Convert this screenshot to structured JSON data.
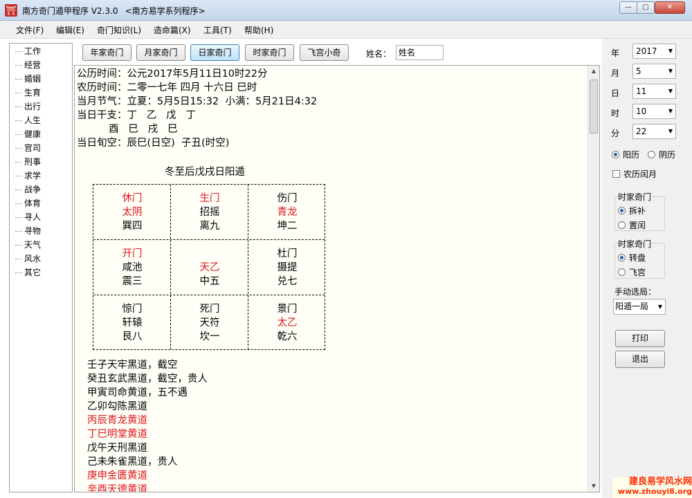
{
  "window": {
    "title": "南方奇门遁甲程序 V2.3.0",
    "subtitle": "<南方易学系列程序>",
    "app_icon": "⛩",
    "min": "—",
    "max": "▢",
    "close": "✕"
  },
  "menu": [
    "文件(F)",
    "编辑(E)",
    "奇门知识(L)",
    "造命篇(X)",
    "工具(T)",
    "帮助(H)"
  ],
  "sidebar": [
    "工作",
    "经营",
    "婚姻",
    "生育",
    "出行",
    "人生",
    "健康",
    "官司",
    "刑事",
    "求学",
    "战争",
    "体育",
    "寻人",
    "寻物",
    "天气",
    "风水",
    "其它"
  ],
  "toolbar": {
    "buttons": [
      "年家奇门",
      "月家奇门",
      "日家奇门",
      "时家奇门",
      "飞宫小奇"
    ],
    "active": "日家奇门",
    "name_label": "姓名：",
    "name_value": "姓名"
  },
  "content": {
    "line1": "公历时间：公元2017年5月11日10时22分",
    "line2": "农历时间：二零一七年 四月 十六日 巳时",
    "line3": "当月节气：立夏：5月5日15:32  小满：5月21日4:32",
    "line4": "当日干支：丁   乙   戊   丁",
    "line5": "          酉   巳   戌   巳",
    "line6": "当日旬空：辰巳(日空)  子丑(时空)",
    "chart_title": "冬至后戊戌日阳遁",
    "cells": [
      {
        "a": "休门",
        "b": "太阴",
        "c": "巽四"
      },
      {
        "a": "生门",
        "b": "招摇",
        "c": "离九"
      },
      {
        "a": "伤门",
        "b": "青龙",
        "c": "坤二"
      },
      {
        "a": "开门",
        "b": "咸池",
        "c": "震三"
      },
      {
        "a": "",
        "b": "天乙",
        "c": "中五"
      },
      {
        "a": "杜门",
        "b": "摄提",
        "c": "兑七"
      },
      {
        "a": "惊门",
        "b": "轩辕",
        "c": "艮八"
      },
      {
        "a": "死门",
        "b": "天符",
        "c": "坎一"
      },
      {
        "a": "景门",
        "b": "太乙",
        "c": "乾六"
      }
    ],
    "hours": [
      "壬子天牢黑道，截空",
      "癸丑玄武黑道，截空，贵人",
      "甲寅司命黄道，五不遇",
      "乙卯勾陈黑道",
      "丙辰青龙黄道",
      "丁巳明堂黄道",
      "戊午天刑黑道",
      "己未朱雀黑道，贵人",
      "庚申金匮黄道",
      "辛酉天德黄道"
    ],
    "red_color": "#e0151b"
  },
  "right": {
    "year_label": "年",
    "year": "2017",
    "month_label": "月",
    "month": "5",
    "day_label": "日",
    "day": "11",
    "hour_label": "时",
    "hour": "10",
    "minute_label": "分",
    "minute": "22",
    "solar": "阳历",
    "lunar": "阴历",
    "leap": "农历闰月",
    "group1_title": "时家奇门",
    "group1_opt1": "拆补",
    "group1_opt2": "置闰",
    "group2_title": "时家奇门",
    "group2_opt1": "转盘",
    "group2_opt2": "飞宫",
    "manual_label": "手动选局：",
    "manual_value": "阳遁一局",
    "print": "打印",
    "exit": "退出"
  },
  "watermark": {
    "line1": "建良易学风水网",
    "line2": "www.zhouyi8.org"
  }
}
